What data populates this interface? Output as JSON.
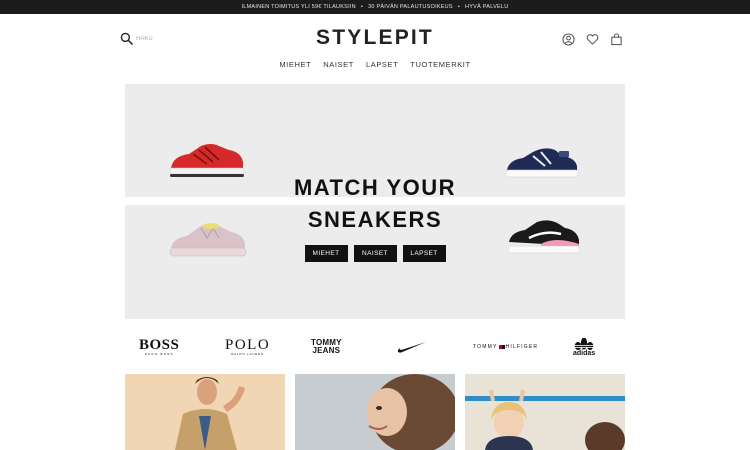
{
  "announcement": {
    "items": [
      "ILMAINEN TOIMITUS YLI 59€ TILAUKSIIN",
      "30 PÄIVÄN PALAUTUSOIKEUS",
      "HYVÄ PALVELU"
    ],
    "separator": "•"
  },
  "header": {
    "search_placeholder": "HAKU",
    "logo": "STYLEPIT",
    "icons": [
      "search-icon",
      "user-icon",
      "heart-icon",
      "bag-icon"
    ]
  },
  "nav": {
    "items": [
      "MIEHET",
      "NAISET",
      "LAPSET",
      "TUOTEMERKIT"
    ]
  },
  "hero": {
    "title_line1": "MATCH YOUR",
    "title_line2": "SNEAKERS",
    "buttons": [
      "MIEHET",
      "NAISET",
      "LAPSET"
    ],
    "background": "#ececec"
  },
  "brands": {
    "boss": {
      "main": "BOSS",
      "sub": "HUGO BOSS"
    },
    "polo": {
      "main": "POLO",
      "sub": "RALPH LAUREN"
    },
    "tommy": {
      "line1": "TOMMY",
      "line2": "JEANS"
    },
    "tommy_hilfiger": {
      "left": "TOMMY",
      "right": "HILFIGER"
    },
    "adidas": {
      "name": "adidas"
    },
    "nike": {
      "icon": "nike-swoosh-icon"
    }
  },
  "colors": {
    "topbar": "#1c1c1c",
    "button": "#111111",
    "accent_red_shoe": "#d62a2a",
    "navy_shoe": "#1f2b55"
  }
}
